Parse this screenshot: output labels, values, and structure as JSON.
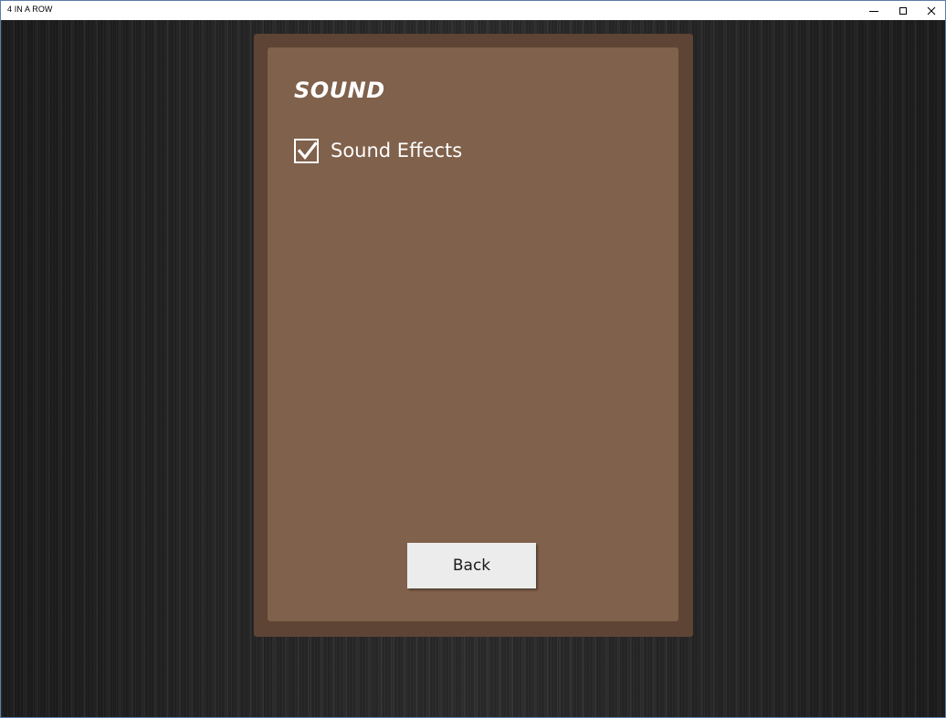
{
  "window": {
    "title": "4 IN A ROW",
    "controls": [
      "minimize-icon",
      "maximize-icon",
      "close-icon"
    ]
  },
  "settings": {
    "heading": "SOUND",
    "options": [
      {
        "label": "Sound Effects",
        "checked": true
      }
    ],
    "back_label": "Back"
  },
  "colors": {
    "panel_outer": "#5e4434",
    "panel_inner": "#80614b",
    "background": "#262626",
    "button": "#ececec"
  }
}
